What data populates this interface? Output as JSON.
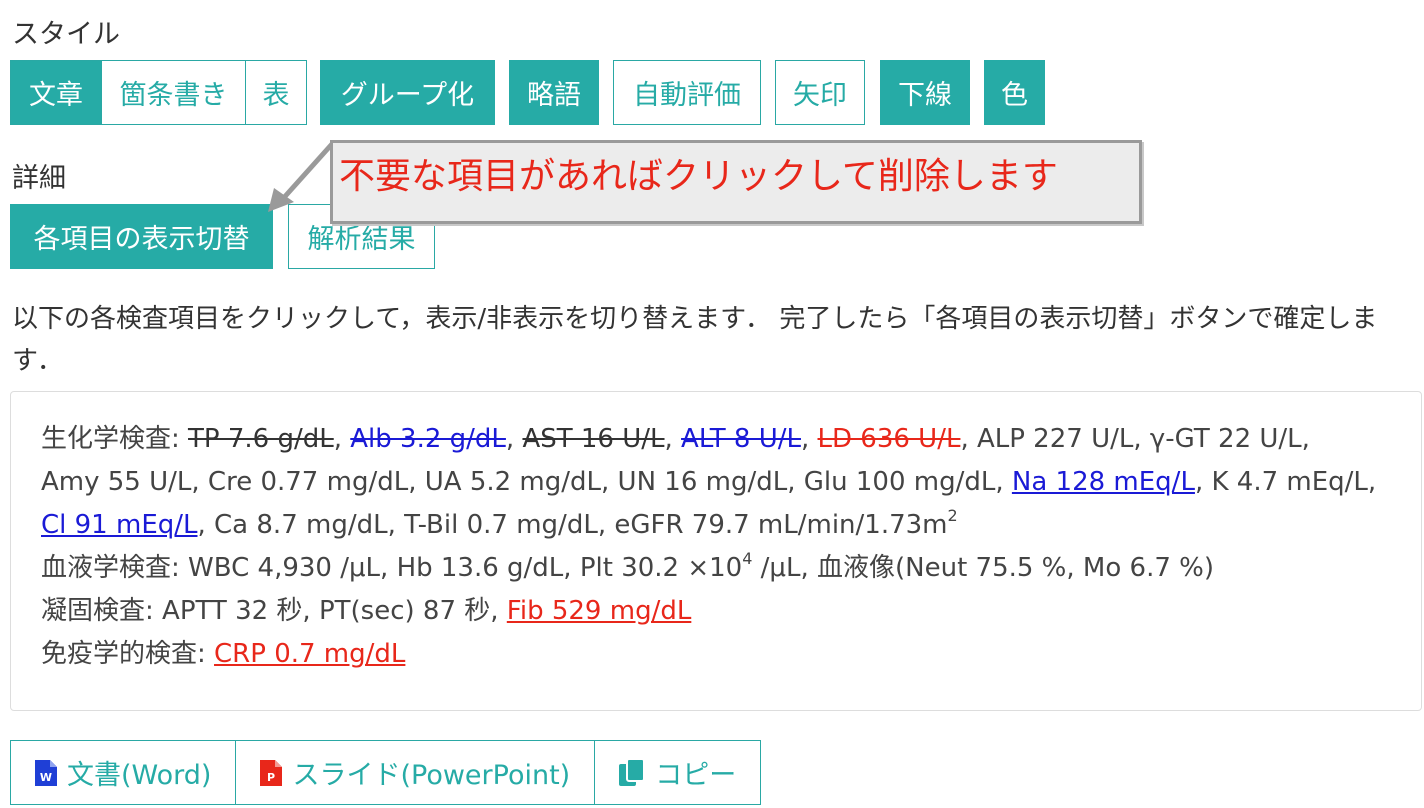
{
  "style_section": {
    "label": "スタイル",
    "format_group": [
      {
        "label": "文章",
        "active": true
      },
      {
        "label": "箇条書き",
        "active": false
      },
      {
        "label": "表",
        "active": false
      }
    ],
    "toggles": [
      {
        "label": "グループ化",
        "active": true
      },
      {
        "label": "略語",
        "active": true
      },
      {
        "label": "自動評価",
        "active": false
      },
      {
        "label": "矢印",
        "active": false
      },
      {
        "label": "下線",
        "active": true
      },
      {
        "label": "色",
        "active": true
      }
    ]
  },
  "detail_section": {
    "label": "詳細",
    "toggle_items_label": "各項目の表示切替",
    "analysis_label": "解析結果"
  },
  "callout": {
    "text": "不要な項目があればクリックして削除します"
  },
  "instructions": "以下の各検査項目をクリックして，表示/非表示を切り替えます． 完了したら「各項目の表示切替」ボタンで確定します．",
  "results": {
    "biochem": {
      "label": "生化学検査:",
      "items": [
        "TP 7.6 g/dL",
        "Alb 3.2 g/dL",
        "AST 16 U/L",
        "ALT 8 U/L",
        "LD 636 U/L",
        "ALP 227 U/L",
        "γ-GT 22 U/L",
        "Amy 55 U/L",
        "Cre 0.77 mg/dL",
        "UA 5.2 mg/dL",
        "UN 16 mg/dL",
        "Glu 100 mg/dL",
        "Na 128 mEq/L",
        "K 4.7 mEq/L",
        "Cl 91 mEq/L",
        "Ca 8.7 mg/dL",
        "T-Bil 0.7 mg/dL"
      ],
      "egfr": "eGFR 79.7 mL/min/1.73m",
      "egfr_sup": "2"
    },
    "hema": {
      "label": "血液学検査:",
      "wbc": "WBC 4,930 /μL",
      "hb": "Hb 13.6 g/dL",
      "plt_pre": "Plt 30.2 ×10",
      "plt_sup": "4",
      "plt_post": " /μL",
      "smear": "血液像(Neut 75.5 %, Mo 6.7 %)"
    },
    "coag": {
      "label": "凝固検査:",
      "items": [
        "APTT 32 秒",
        "PT(sec) 87 秒",
        "Fib 529 mg/dL"
      ]
    },
    "immuno": {
      "label": "免疫学的検査:",
      "items": [
        "CRP 0.7 mg/dL"
      ]
    }
  },
  "export": {
    "word": "文書(Word)",
    "ppt": "スライド(PowerPoint)",
    "copy": "コピー"
  },
  "colors": {
    "accent": "#26aba6",
    "high": "#e8271a",
    "low": "#1a1ad6"
  }
}
